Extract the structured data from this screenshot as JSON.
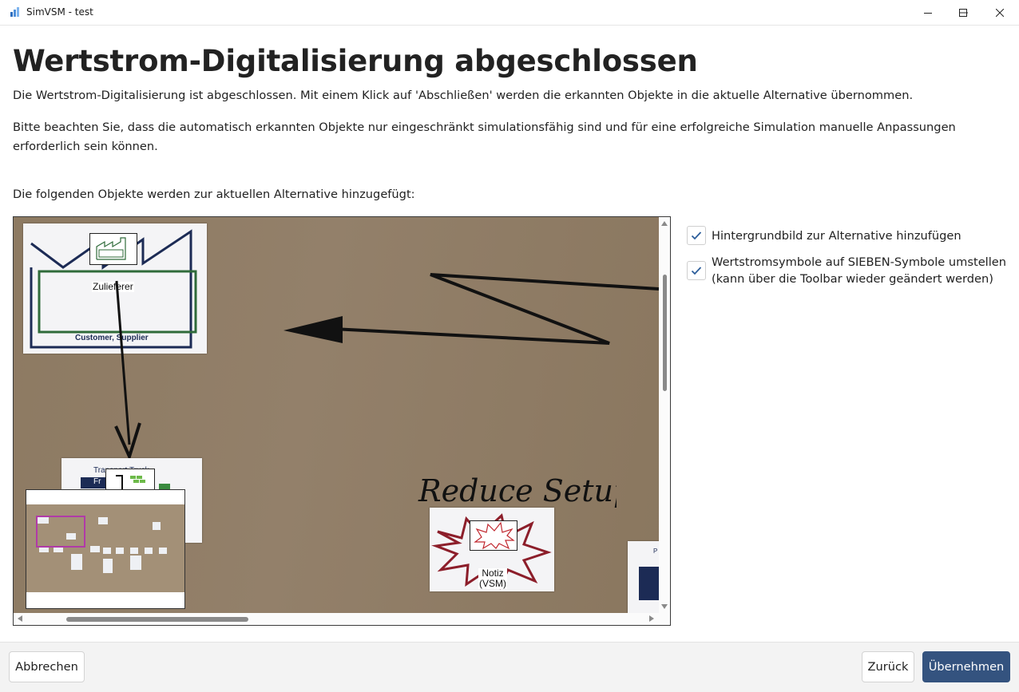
{
  "window": {
    "title": "SimVSM - test",
    "controls": [
      "minimize-icon",
      "maximize-icon",
      "close-icon"
    ]
  },
  "main": {
    "heading": "Wertstrom-Digitalisierung abgeschlossen",
    "paragraph1": "Die Wertstrom-Digitalisierung ist abgeschlossen. Mit einem Klick auf 'Abschließen' werden die erkannten Objekte in die aktuelle Alternative übernommen.",
    "paragraph2": "Bitte beachten Sie, dass die automatisch erkannten Objekte nur eingeschränkt simulationsfähig sind und für eine erfolgreiche Simulation manuelle Anpassungen erforderlich sein können.",
    "paragraph3": "Die folgenden Objekte werden zur aktuellen Alternative hinzugefügt:"
  },
  "preview": {
    "detected": [
      {
        "label": "Zulieferer",
        "icon": "factory-icon"
      },
      {
        "label": "Notiz\n(VSM)",
        "icon": "kaizen-burst-icon"
      }
    ],
    "sheet_texts": {
      "customer_supplier": "Customer, Supplier",
      "transport_truck": "Transport Truck",
      "fr": "Fr",
      "handwriting": "Reduce Setup",
      "right_sheet_letter": "P"
    }
  },
  "options": {
    "add_background": {
      "label": "Hintergrundbild zur Alternative hinzufügen",
      "checked": true
    },
    "switch_symbols": {
      "label_line1": "Wertstromsymbole auf SIEBEN-Symbole umstellen",
      "label_line2": "(kann über die Toolbar wieder geändert werden)",
      "checked": true
    }
  },
  "footer": {
    "cancel": "Abbrechen",
    "back": "Zurück",
    "apply": "Übernehmen"
  },
  "colors": {
    "primary": "#34537f",
    "minimap_viewport": "#b13aa8",
    "check": "#2b5d9a"
  }
}
